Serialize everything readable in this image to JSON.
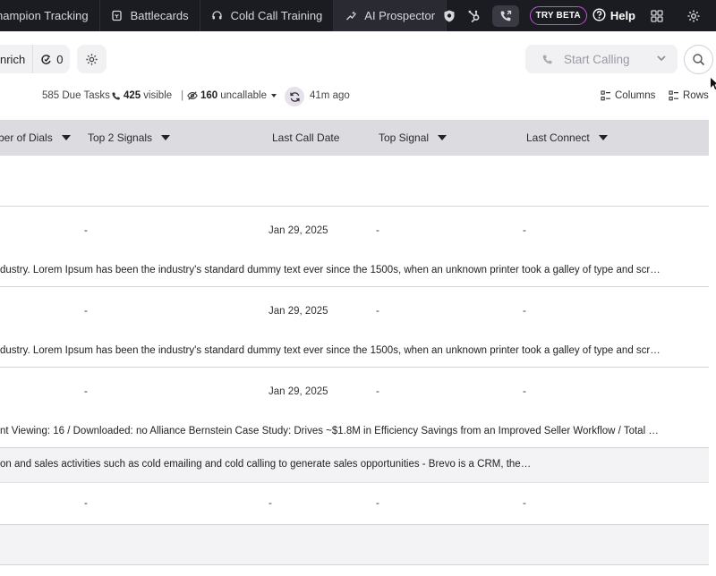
{
  "nav": {
    "items": [
      {
        "label": "hampion Tracking",
        "icon": "none"
      },
      {
        "label": "Battlecards",
        "icon": "battlecard-icon"
      },
      {
        "label": "Cold Call Training",
        "icon": "headset-icon"
      },
      {
        "label": "AI Prospector",
        "icon": "ai-prospector-icon"
      }
    ],
    "try_beta": "TRY BETA",
    "help": "Help"
  },
  "toolbar": {
    "enrich_label": "nrich",
    "count_value": "0",
    "start_calling": "Start Calling"
  },
  "stats": {
    "due_tasks": "585 Due Tasks",
    "visible_count": "425",
    "visible_label": "visible",
    "separator": "|",
    "uncallable_count": "160",
    "uncallable_label": "uncallable",
    "synced_ago": "41m ago",
    "columns_label": "Columns",
    "rows_label": "Rows"
  },
  "table": {
    "headers": [
      "ber of Dials",
      "Top 2 Signals",
      "Last Call Date",
      "Top Signal",
      "Last Connect"
    ],
    "rows": [
      {
        "top2": "-",
        "date": "Jan 29, 2025",
        "signal": "-",
        "connect": "-",
        "desc": "dustry. Lorem Ipsum has been the industry's standard dummy text ever since the 1500s, when an unknown printer took a galley of type and scr…"
      },
      {
        "top2": "-",
        "date": "Jan 29, 2025",
        "signal": "-",
        "connect": "-",
        "desc": "dustry. Lorem Ipsum has been the industry's standard dummy text ever since the 1500s, when an unknown printer took a galley of type and scr…"
      },
      {
        "top2": "-",
        "date": "Jan 29, 2025",
        "signal": "-",
        "connect": "-",
        "desc": "nt Viewing: 16 / Downloaded: no Alliance Bernstein Case Study: Drives ~$1.8M in Efficiency Savings from an Improved Seller Workflow / Total …"
      },
      {
        "top2": "-",
        "date": "-",
        "signal": "-",
        "connect": "-",
        "desc": "on and sales activities such as cold emailing and cold calling to generate sales opportunities - Brevo is a CRM, the…"
      }
    ]
  },
  "colors": {
    "topbar_bg": "#1b1b22",
    "header_bg": "#dcdce0",
    "beta_border": "#c44fd8",
    "refresh_bg": "#e6e1ec"
  }
}
